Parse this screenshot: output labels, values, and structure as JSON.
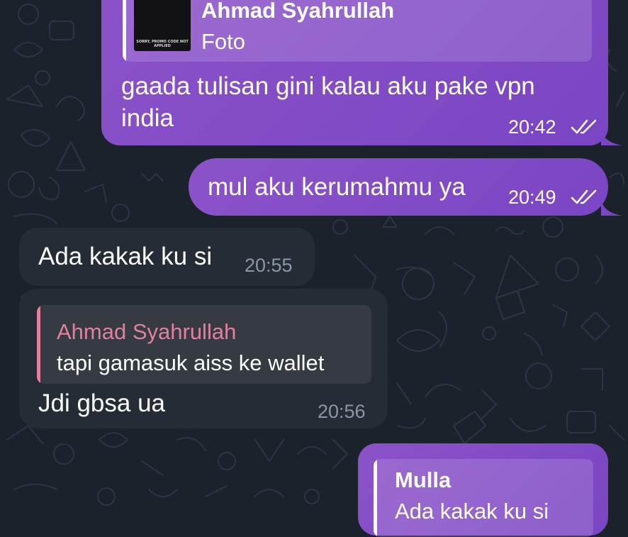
{
  "theme": {
    "background": "#1b222c",
    "outgoing_bubble": "#8250c6",
    "incoming_bubble": "#262c35",
    "incoming_reply_name": "#e2809e",
    "incoming_reply_bar": "#e2809e",
    "outgoing_reply_bar": "#ffffff",
    "timestamp_incoming": "#8b97a5"
  },
  "messages": [
    {
      "id": "m1",
      "direction": "outgoing",
      "reply": {
        "name": "Ahmad Syahrullah",
        "text": "Foto",
        "thumbnail_icon": "photo-thumbnail",
        "thumbnail_caption_1": "SORRY, PROMO CODE NOT",
        "thumbnail_caption_2": "APPLIED"
      },
      "text_line_1": "gaada tulisan gini kalau aku pake vpn",
      "text_line_2": "india",
      "time": "20:42",
      "status_icon": "double-check-icon"
    },
    {
      "id": "m2",
      "direction": "outgoing",
      "text": "mul aku kerumahmu ya",
      "time": "20:49",
      "status_icon": "double-check-icon"
    },
    {
      "id": "m3",
      "direction": "incoming",
      "text": "Ada kakak ku si",
      "time": "20:55"
    },
    {
      "id": "m4",
      "direction": "incoming",
      "reply": {
        "name": "Ahmad Syahrullah",
        "text": "tapi gamasuk aiss ke wallet"
      },
      "text": "Jdi gbsa ua",
      "time": "20:56"
    },
    {
      "id": "m5",
      "direction": "outgoing",
      "reply": {
        "name": "Mulla",
        "text": "Ada kakak ku si"
      }
    }
  ]
}
